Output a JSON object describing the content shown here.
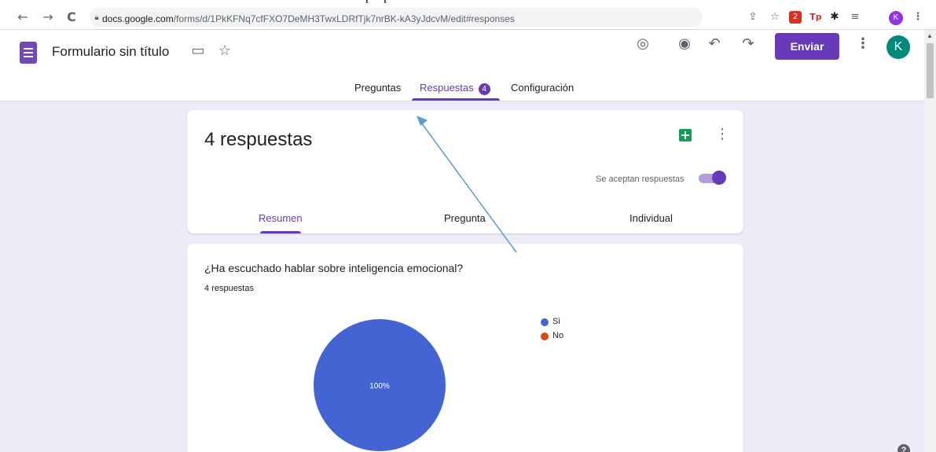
{
  "browser": {
    "url_host": "docs.google.com",
    "url_path": "/forms/d/1PkKFNq7cfFXO7DeMH3TwxLDRfTjk7nrBK-kA3yJdcvM/edit#responses",
    "profile_initial": "K",
    "icons": [
      "back-icon",
      "forward-icon",
      "reload-icon",
      "lock-icon",
      "share-icon",
      "bookmark-star-icon",
      "extension-icon",
      "puzzle-icon",
      "media-icon",
      "menu-icon"
    ]
  },
  "header": {
    "title": "Formulario sin título",
    "send_label": "Enviar",
    "avatar_initial": "K",
    "colors": {
      "accent": "#673ab7",
      "avatar": "#00897b",
      "background": "#f0ebf8"
    }
  },
  "tabs": [
    {
      "label": "Preguntas",
      "active": false
    },
    {
      "label": "Respuestas",
      "active": true,
      "badge": "4"
    },
    {
      "label": "Configuración",
      "active": false
    }
  ],
  "summary": {
    "title": "4 respuestas",
    "accepting_label": "Se aceptan respuestas",
    "accepting": true,
    "sub_tabs": [
      {
        "label": "Resumen",
        "active": true
      },
      {
        "label": "Pregunta",
        "active": false
      },
      {
        "label": "Individual",
        "active": false
      }
    ]
  },
  "question": {
    "title": "¿Ha escuchado hablar sobre inteligencia emocional?",
    "count_label": "4 respuestas"
  },
  "chart_data": {
    "type": "pie",
    "categories": [
      "Si",
      "No"
    ],
    "values": [
      100,
      0
    ],
    "data_labels": [
      "100%",
      ""
    ],
    "colors": [
      "#4464d4",
      "#dc4814"
    ],
    "legend": "right"
  }
}
